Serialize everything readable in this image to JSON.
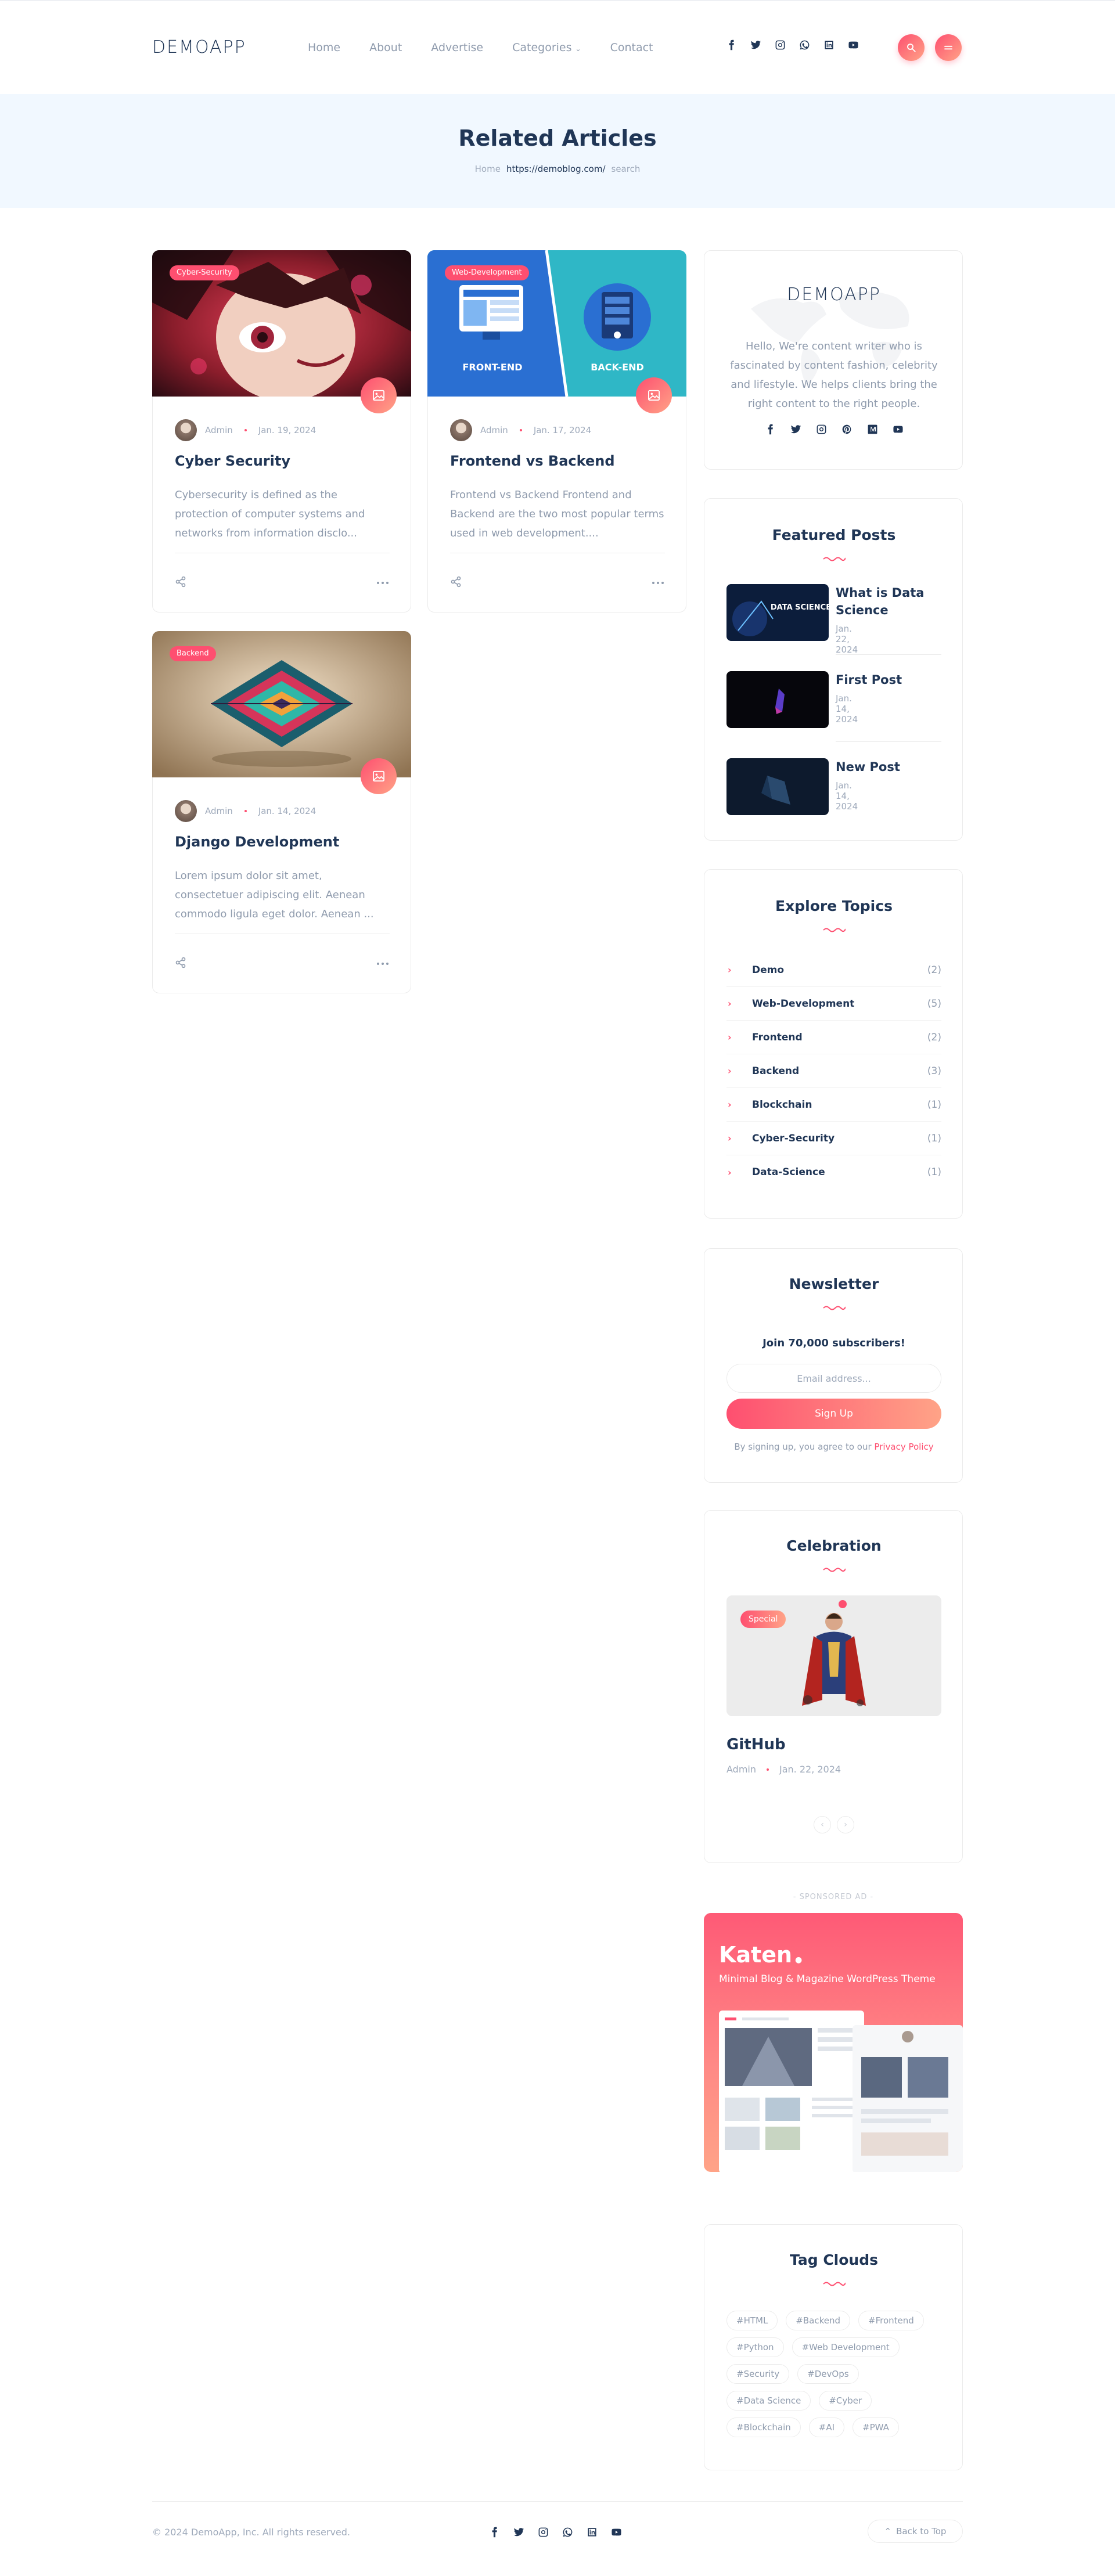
{
  "header": {
    "logo": "DEMOAPP",
    "nav": [
      "Home",
      "About",
      "Advertise",
      "Categories",
      "Contact"
    ],
    "socials": [
      "facebook-icon",
      "twitter-icon",
      "instagram-icon",
      "whatsapp-icon",
      "linkedin-icon",
      "youtube-icon"
    ],
    "accent": "#fe4f70"
  },
  "page_header": {
    "title": "Related Articles",
    "breadcrumb": [
      "Home",
      "https://demoblog.com/",
      "search"
    ]
  },
  "posts": [
    {
      "category": "Cyber-Security",
      "author": "Admin",
      "date": "Jan. 19, 2024",
      "title": "Cyber Security",
      "excerpt": "Cybersecurity is defined as the protection of computer systems and networks from information disclo..."
    },
    {
      "category": "Web-Development",
      "author": "Admin",
      "date": "Jan. 17, 2024",
      "title": "Frontend vs Backend",
      "excerpt": "Frontend vs Backend Frontend and Backend are the two most popular terms used in web development....",
      "thumb_labels": [
        "FRONT-END",
        "BACK-END"
      ]
    },
    {
      "category": "Backend",
      "author": "Admin",
      "date": "Jan. 14, 2024",
      "title": "Django Development",
      "excerpt": "Lorem ipsum dolor sit amet, consectetuer adipiscing elit. Aenean commodo ligula eget dolor. Aenean ..."
    }
  ],
  "about": {
    "logo": "DEMOAPP",
    "text": "Hello, We're content writer who is fascinated by content fashion, celebrity and lifestyle. We helps clients bring the right content to the right people."
  },
  "featured": {
    "title": "Featured Posts",
    "items": [
      {
        "title": "What is Data Science",
        "date": "Jan. 22, 2024",
        "thumb_text": "DATA SCIENCE"
      },
      {
        "title": "First Post",
        "date": "Jan. 14, 2024"
      },
      {
        "title": "New Post",
        "date": "Jan. 14, 2024"
      }
    ]
  },
  "topics": {
    "title": "Explore Topics",
    "items": [
      {
        "name": "Demo",
        "count": "(2)"
      },
      {
        "name": "Web-Development",
        "count": "(5)"
      },
      {
        "name": "Frontend",
        "count": "(2)"
      },
      {
        "name": "Backend",
        "count": "(3)"
      },
      {
        "name": "Blockchain",
        "count": "(1)"
      },
      {
        "name": "Cyber-Security",
        "count": "(1)"
      },
      {
        "name": "Data-Science",
        "count": "(1)"
      }
    ]
  },
  "newsletter": {
    "title": "Newsletter",
    "subtitle": "Join 70,000 subscribers!",
    "placeholder": "Email address...",
    "button": "Sign Up",
    "note": "By signing up, you agree to our",
    "policy": "Privacy Policy"
  },
  "celebration": {
    "title": "Celebration",
    "badge": "Special",
    "post_title": "GitHub",
    "author": "Admin",
    "date": "Jan. 22, 2024"
  },
  "ad": {
    "label": "- SPONSORED AD -",
    "brand": "Katen",
    "tagline": "Minimal Blog & Magazine WordPress Theme"
  },
  "tag_cloud": {
    "title": "Tag Clouds",
    "tags": [
      "#HTML",
      "#Backend",
      "#Frontend",
      "#Python",
      "#Web Development",
      "#Security",
      "#DevOps",
      "#Data Science",
      "#Cyber",
      "#Blockchain",
      "#AI",
      "#PWA"
    ]
  },
  "footer": {
    "copyright": "© 2024 DemoApp, Inc. All rights reserved.",
    "back_to_top": "Back to Top"
  }
}
